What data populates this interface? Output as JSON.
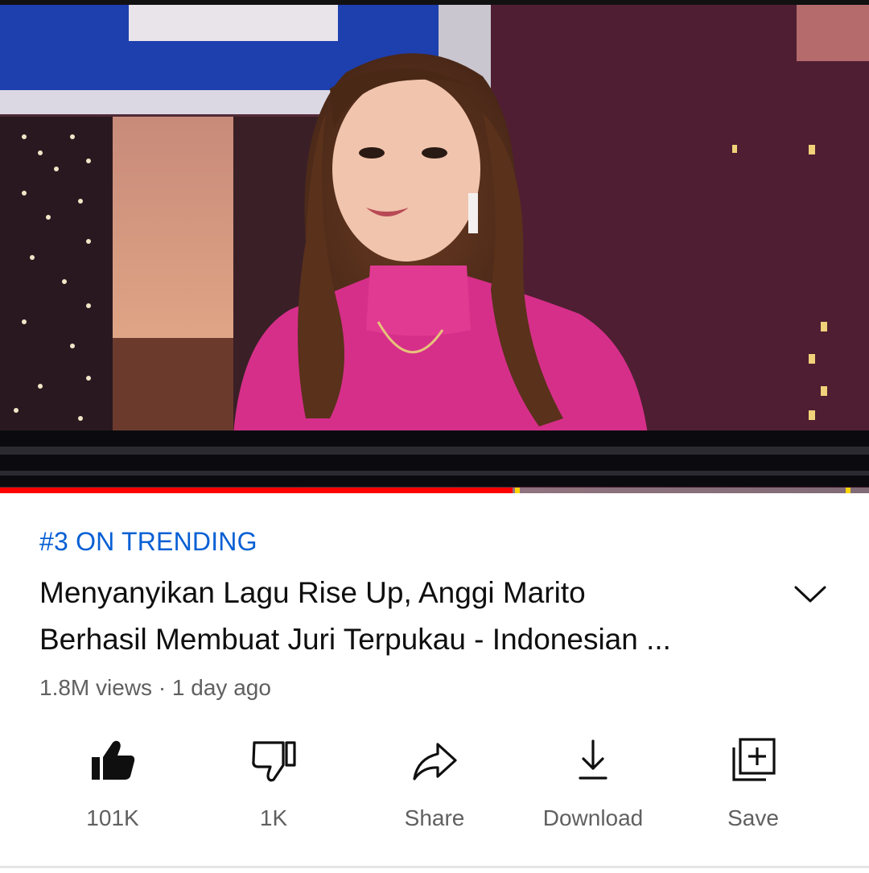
{
  "video": {
    "player_label": "video-player",
    "progress": 0.59,
    "buffered": 0.73,
    "markers": [
      0.593,
      0.973
    ]
  },
  "trending": "#3 ON TRENDING",
  "title": {
    "line1": "Menyanyikan Lagu Rise Up, Anggi Marito",
    "line2": "Berhasil Membuat Juri Terpukau - Indonesian ..."
  },
  "meta": "1.8M views · 1 day ago",
  "actions": {
    "like": {
      "label": "101K",
      "icon": "thumbs-up-icon"
    },
    "dislike": {
      "label": "1K",
      "icon": "thumbs-down-icon"
    },
    "share": {
      "label": "Share",
      "icon": "share-icon"
    },
    "download": {
      "label": "Download",
      "icon": "download-icon"
    },
    "save": {
      "label": "Save",
      "icon": "add-to-playlist-icon"
    }
  },
  "colors": {
    "accent": "#065fd4",
    "progress": "#ff0000",
    "text": "#0f0f0f",
    "muted": "#606060"
  }
}
